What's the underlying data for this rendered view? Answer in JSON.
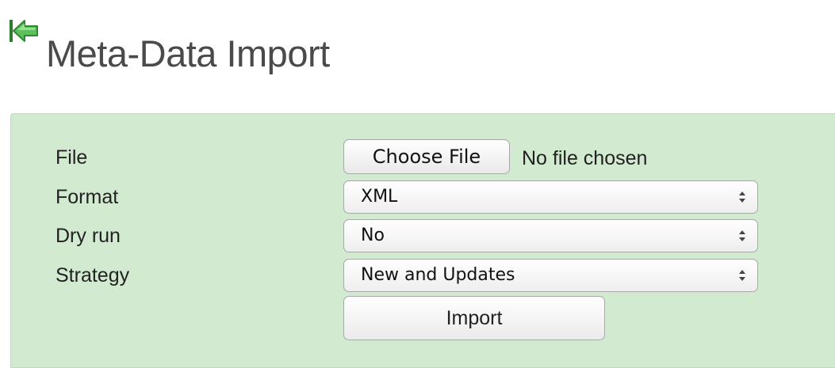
{
  "header": {
    "title": "Meta-Data Import",
    "back_icon": "back-arrow-icon",
    "back_icon_color": "#4cb34c"
  },
  "form": {
    "background_color": "#d1ead0",
    "fields": {
      "file": {
        "label": "File",
        "button_label": "Choose File",
        "status": "No file chosen"
      },
      "format": {
        "label": "Format",
        "value": "XML"
      },
      "dry_run": {
        "label": "Dry run",
        "value": "No"
      },
      "strategy": {
        "label": "Strategy",
        "value": "New and Updates"
      }
    },
    "submit_label": "Import"
  }
}
